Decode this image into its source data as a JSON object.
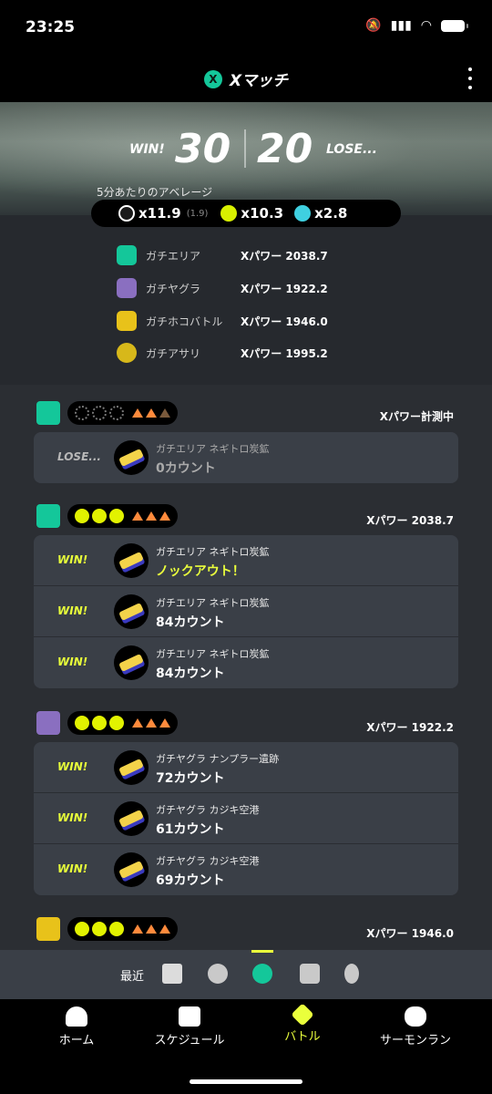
{
  "status_bar": {
    "time": "23:25"
  },
  "header": {
    "title": "Xマッチ",
    "badge": "X"
  },
  "summary": {
    "win_label": "WIN!",
    "win_count": "30",
    "lose_count": "20",
    "lose_label": "LOSE...",
    "average_label": "5分あたりのアベレージ",
    "stats": [
      {
        "icon": "kill-assist-icon",
        "value": "x11.9",
        "sub": "(1.9)"
      },
      {
        "icon": "death-icon",
        "value": "x10.3"
      },
      {
        "icon": "special-icon",
        "value": "x2.8"
      }
    ]
  },
  "modes": [
    {
      "icon": "splat-zones-icon",
      "name": "ガチエリア",
      "power": "Xパワー 2038.7",
      "color": "#14c79a"
    },
    {
      "icon": "tower-control-icon",
      "name": "ガチヤグラ",
      "power": "Xパワー 1922.2",
      "color": "#8a6fc0"
    },
    {
      "icon": "rainmaker-icon",
      "name": "ガチホコバトル",
      "power": "Xパワー 1946.0",
      "color": "#e8c21a"
    },
    {
      "icon": "clam-blitz-icon",
      "name": "ガチアサリ",
      "power": "Xパワー 1995.2",
      "color": "#d7b81a"
    }
  ],
  "sections": [
    {
      "power": "Xパワー計測中",
      "rows": [
        {
          "result": "LOSE...",
          "stage": "ガチエリア ネギトロ炭鉱",
          "count": "0カウント",
          "lose": true
        }
      ]
    },
    {
      "power": "Xパワー 2038.7",
      "rows": [
        {
          "result": "WIN!",
          "stage": "ガチエリア ネギトロ炭鉱",
          "count": "ノックアウト！",
          "ko": true
        },
        {
          "result": "WIN!",
          "stage": "ガチエリア ネギトロ炭鉱",
          "count": "84カウント"
        },
        {
          "result": "WIN!",
          "stage": "ガチエリア ネギトロ炭鉱",
          "count": "84カウント"
        }
      ]
    },
    {
      "power": "Xパワー 1922.2",
      "rows": [
        {
          "result": "WIN!",
          "stage": "ガチヤグラ ナンプラー遺跡",
          "count": "72カウント"
        },
        {
          "result": "WIN!",
          "stage": "ガチヤグラ カジキ空港",
          "count": "61カウント"
        },
        {
          "result": "WIN!",
          "stage": "ガチヤグラ カジキ空港",
          "count": "69カウント"
        }
      ]
    },
    {
      "power": "Xパワー 1946.0",
      "rows": []
    }
  ],
  "recent_bar": {
    "label": "最近",
    "icons": [
      "battle-all-icon",
      "anarchy-icon",
      "x-match-icon",
      "private-icon",
      "salmon-icon"
    ]
  },
  "tabs": [
    {
      "label": "ホーム",
      "icon": "squid-icon"
    },
    {
      "label": "スケジュール",
      "icon": "calendar-icon"
    },
    {
      "label": "バトル",
      "icon": "battle-icon"
    },
    {
      "label": "サーモンラン",
      "icon": "salmon-run-icon"
    }
  ]
}
